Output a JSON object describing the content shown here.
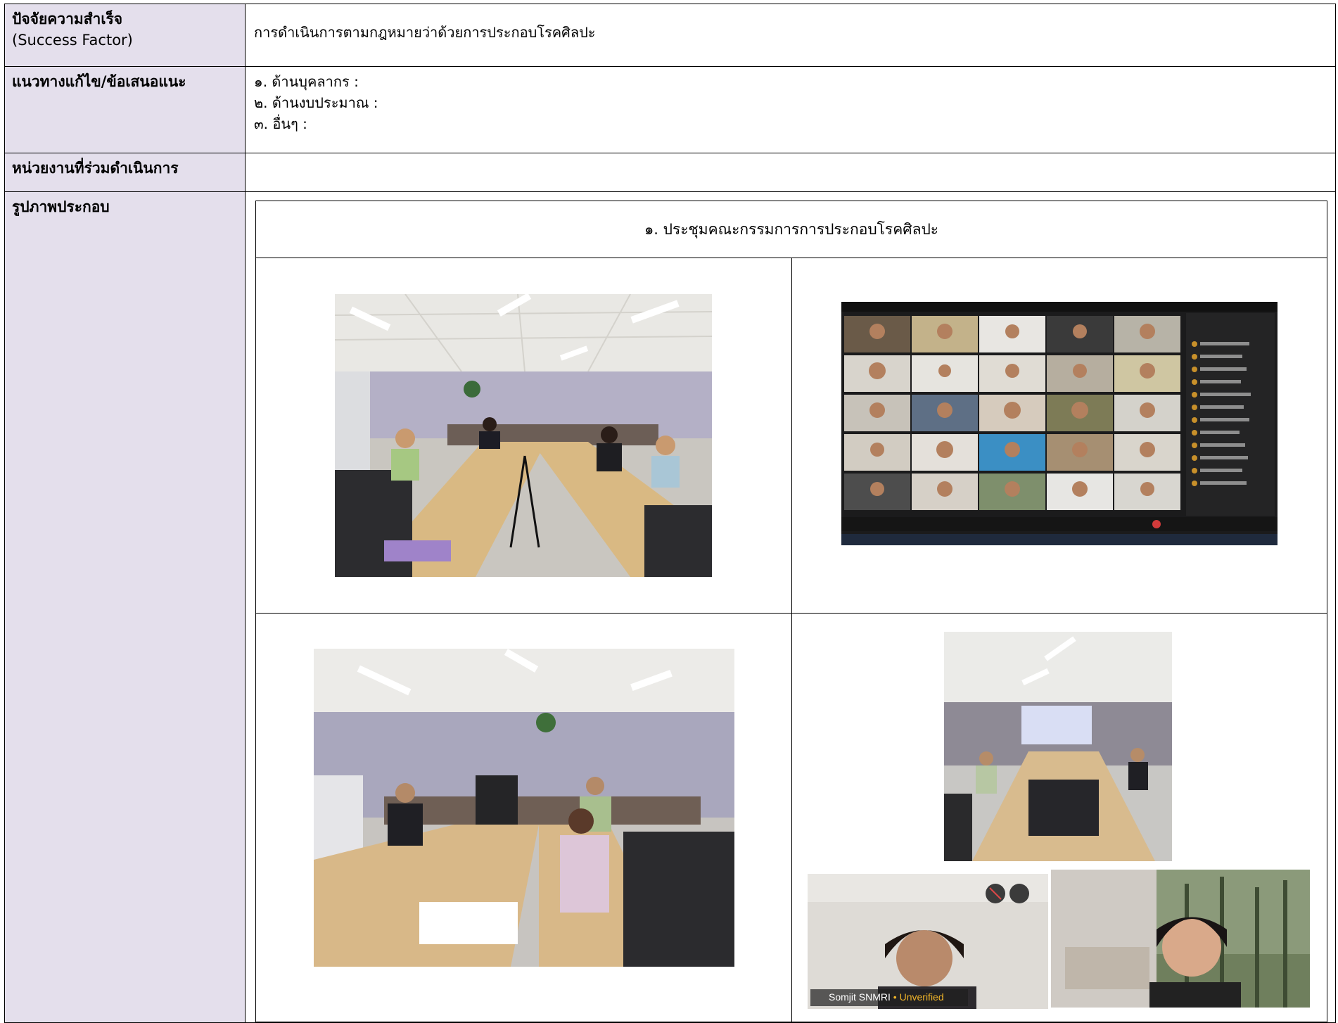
{
  "success_factor": {
    "label_line1": "ปัจจัยความสำเร็จ",
    "label_line2": "(Success Factor)",
    "value": "การดำเนินการตามกฎหมายว่าด้วยการประกอบโรคศิลปะ"
  },
  "solutions": {
    "label": "แนวทางแก้ไข/ข้อเสนอแนะ",
    "items": [
      "๑. ด้านบุคลากร :",
      "๒. ด้านงบประมาณ :",
      "๓. อื่นๆ :"
    ]
  },
  "agencies": {
    "label": "หน่วยงานที่ร่วมดำเนินการ",
    "value": ""
  },
  "photos": {
    "label": "รูปภาพประกอบ",
    "caption": "๑. ประชุมคณะกรรมการการประกอบโรคศิลปะ",
    "video_tile_name": "Somjit SNMRI",
    "video_tile_status": "Unverified"
  }
}
